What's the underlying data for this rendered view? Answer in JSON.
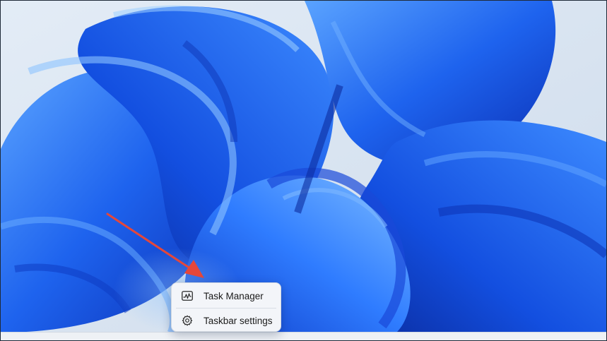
{
  "context_menu": {
    "items": [
      {
        "label": "Task Manager",
        "icon": "task-manager-icon"
      },
      {
        "label": "Taskbar settings",
        "icon": "gear-icon"
      }
    ]
  },
  "annotation": {
    "arrow_color": "#e5473a"
  },
  "wallpaper": {
    "accent": "#1f5ee8",
    "background": "#dbe6f2"
  }
}
